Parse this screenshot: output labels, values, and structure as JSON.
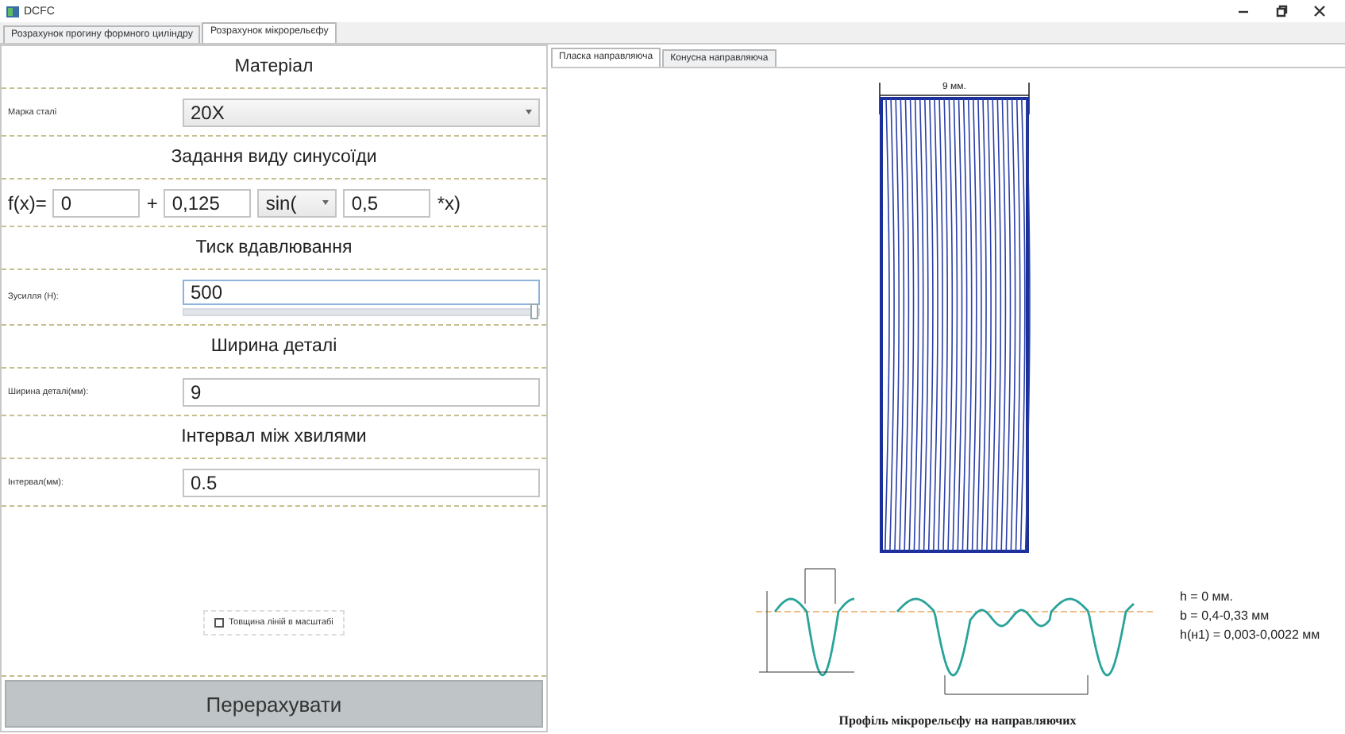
{
  "window": {
    "title": "DCFC"
  },
  "tabs": [
    {
      "label": "Розрахунок прогину формного циліндру",
      "selected": false
    },
    {
      "label": "Розрахунок мікрорельєфу",
      "selected": true
    }
  ],
  "form": [
    {
      "kind": "header",
      "text": "Матеріал"
    },
    {
      "kind": "combo",
      "label": "Марка сталі",
      "value": "20X"
    },
    {
      "kind": "header",
      "text": "Задання виду синусоїди"
    },
    {
      "kind": "formula",
      "prefix": "f(x)=",
      "a": "0",
      "plus": "+",
      "b": "0,125",
      "func": "sin(",
      "c": "0,5",
      "suffix": "*x)"
    },
    {
      "kind": "header",
      "text": "Тиск вдавлювання"
    },
    {
      "kind": "slider",
      "label": "Зусилля (Н):",
      "value": "500",
      "level": 1.0
    },
    {
      "kind": "header",
      "text": "Ширина деталі"
    },
    {
      "kind": "field",
      "label": "Ширина деталі(мм):",
      "value": "9"
    },
    {
      "kind": "header",
      "text": "Інтервал між хвилями"
    },
    {
      "kind": "field",
      "label": "Інтервал(мм):",
      "value": "0.5"
    }
  ],
  "checkbox": {
    "label": "Товщина ліній в масштабі",
    "checked": false
  },
  "button": "Перерахувати",
  "inner_tabs": [
    {
      "label": "Пласка направляюча",
      "selected": true
    },
    {
      "label": "Конусна направляюча",
      "selected": false
    }
  ],
  "plate": {
    "width_label": "9 мм."
  },
  "profile": {
    "caption": "Профіль мікрорельєфу на направляючих",
    "notes": [
      "h = 0 мм.",
      "b = 0,4-0,33 мм",
      "h(н1) = 0,003-0,0022 мм"
    ]
  }
}
